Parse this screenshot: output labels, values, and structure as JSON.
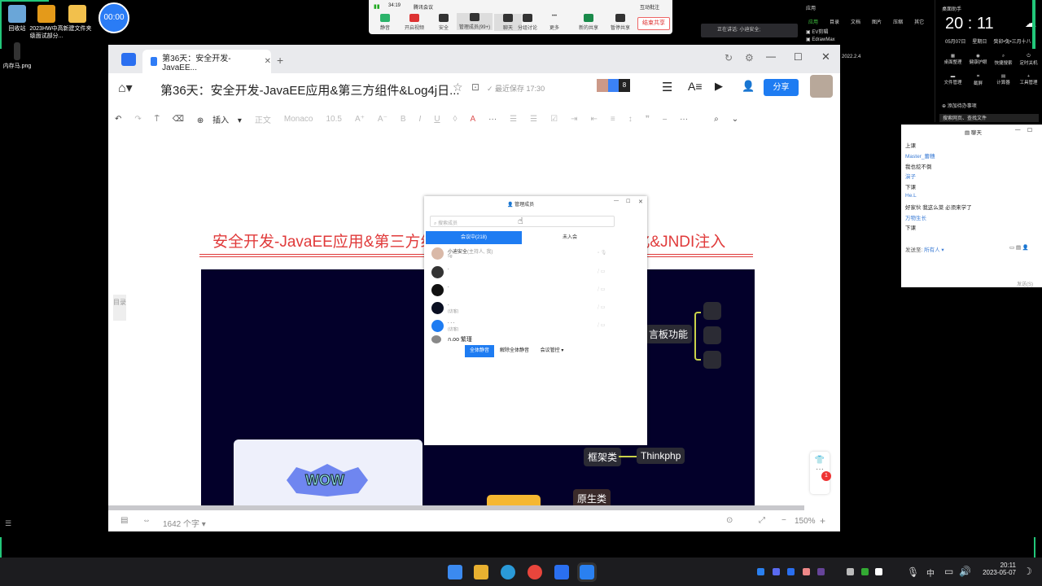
{
  "desktop": {
    "icons": [
      {
        "label": "回收站"
      },
      {
        "label": "2023HW中高级面试部分..."
      },
      {
        "label": "新建文件夹"
      },
      {
        "label": "内存马.png"
      }
    ],
    "timer": "00:00"
  },
  "meeting": {
    "signal": "34:19",
    "title": "腾讯会议",
    "annotate": "互动批注",
    "buttons": [
      "静音",
      "开启视频",
      "安全",
      "管理成员(99+)",
      "聊天",
      "分组讨论",
      "更多",
      "新的共享",
      "暂停共享"
    ],
    "end_share": "结束共享",
    "speaking": "正在讲话: 小迪安全;"
  },
  "browser": {
    "tab_title": "第36天：安全开发-JavaEE...",
    "doc_title": "第36天：安全开发-JavaEE应用&第三方组件&Log4j日...",
    "saved": "最近保存 17:30",
    "collab_count": "8",
    "share": "分享",
    "toolbar": {
      "insert": "插入",
      "style": "正文",
      "font": "Monaco",
      "size": "10.5"
    },
    "heading": "安全开发-JavaEE应用&第三方组件&Log4j日志&FastJson序列化&JNDI注入",
    "outline": "目录",
    "mindmap": {
      "nodes": [
        "言板功能",
        "框架类",
        "Thinkphp",
        "原生类"
      ],
      "sticker": "WOW"
    },
    "status": {
      "word_count": "1642 个字",
      "zoom": "150%"
    },
    "badge": "1"
  },
  "members": {
    "title": "管理成员",
    "search_placeholder": "搜索成员",
    "tab_in": "会议中(218)",
    "tab_out": "未入会",
    "rows": [
      {
        "name": "小迪安全",
        "role": "(主持人, 我)",
        "sub": "5g"
      },
      {
        "name": ".",
        "sub": ""
      },
      {
        "name": ".",
        "sub": ""
      },
      {
        "name": ".",
        "sub": "(访客)"
      },
      {
        "name": ". . .",
        "sub": "(访客)"
      },
      {
        "name": "ก.oo 繁瑾",
        "sub": ""
      }
    ],
    "mute_all": "全体静音",
    "unmute_all": "解除全体静音",
    "control": "会议管控"
  },
  "chat": {
    "title": "聊天",
    "messages": [
      {
        "t": "上课",
        "s": false
      },
      {
        "t": "Master_蕾穗",
        "s": true
      },
      {
        "t": "我也挖不倒",
        "s": false
      },
      {
        "t": "演子",
        "s": true
      },
      {
        "t": "下课",
        "s": false
      },
      {
        "t": "He.L",
        "s": true
      },
      {
        "t": "好家伙 我这么菜 必须来学了",
        "s": false
      },
      {
        "t": "万物生长",
        "s": true
      },
      {
        "t": "下课",
        "s": false
      }
    ],
    "send_to": "发送至:",
    "recipient": "所有人",
    "send": "发送(S)"
  },
  "apps": {
    "title": "应用",
    "tabs": [
      "应用",
      "目录",
      "文档",
      "图片",
      "压缩",
      "其它"
    ],
    "items": [
      "EV剪辑",
      "EdrawMax",
      "2022.2.4"
    ]
  },
  "assistant": {
    "title": "桌面助手",
    "time": "20 : 11",
    "date": "05月07日",
    "weekday": "星期日",
    "lunar": "癸卯•兔•三月十八",
    "tools": [
      "桌面整理",
      "健康护眼",
      "快捷搜索",
      "定时关机",
      "文件管理",
      "截屏",
      "计算器",
      "工具管理"
    ],
    "todo": "添加待办事项",
    "search": "搜索网页、查找文件"
  },
  "taskbar": {
    "ime": "中",
    "time": "20:11",
    "date": "2023-05-07"
  }
}
